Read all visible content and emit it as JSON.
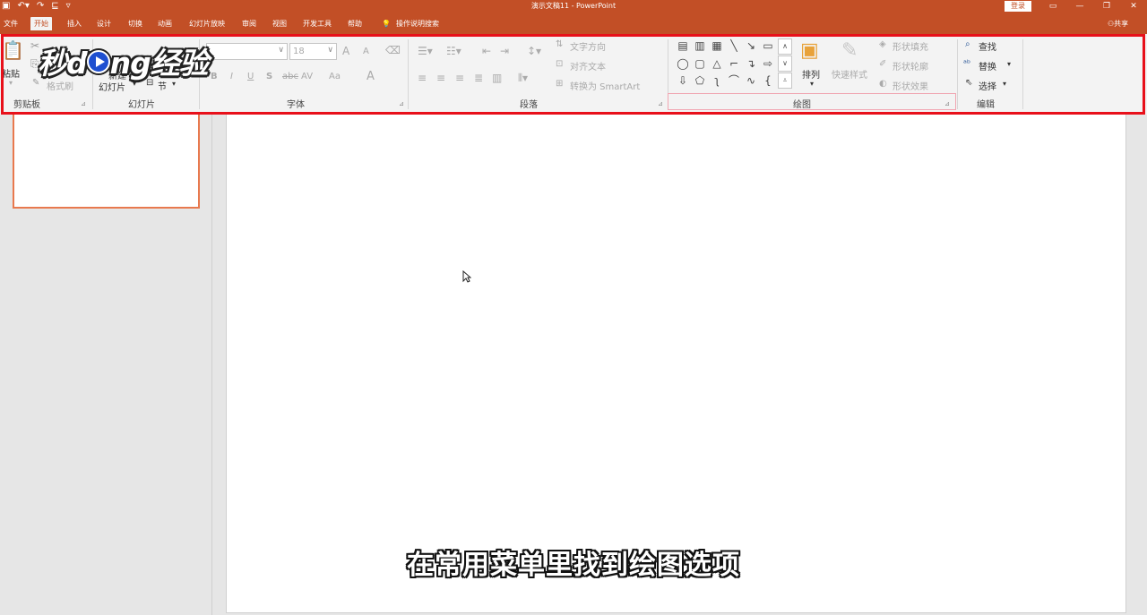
{
  "titlebar": {
    "title": "演示文稿11  -  PowerPoint",
    "login": "登录",
    "qa_icons": [
      "save-icon",
      "undo-icon",
      "redo-icon",
      "start-slideshow-icon",
      "customize-icon"
    ],
    "qa_glyphs": [
      "▣",
      "↶▾",
      "↷",
      "⊑",
      "▿"
    ],
    "winctl": [
      "▭",
      "—",
      "❐",
      "✕"
    ]
  },
  "tabs": [
    "文件",
    "开始",
    "插入",
    "设计",
    "切换",
    "动画",
    "幻灯片放映",
    "审阅",
    "视图",
    "开发工具",
    "帮助",
    "操作说明搜索"
  ],
  "active_tab": "开始",
  "share": "共享",
  "ribbon": {
    "clipboard": {
      "paste": "粘贴",
      "format_painter": "格式刷",
      "label": "剪贴板"
    },
    "slides": {
      "new_slide_1": "新建",
      "new_slide_2": "幻灯片",
      "section": "节",
      "label": "幻灯片"
    },
    "font": {
      "size": "18",
      "bold": "B",
      "italic": "I",
      "underline": "U",
      "shadow": "S",
      "strike": "abc",
      "spacing": "AV",
      "case": "Aa",
      "color": "A",
      "grow": "A",
      "shrink": "A",
      "label": "字体"
    },
    "paragraph": {
      "text_direction": "文字方向",
      "align_text": "对齐文本",
      "smartart": "转换为 SmartArt",
      "label": "段落"
    },
    "drawing": {
      "arrange": "排列",
      "quick_styles": "快速样式",
      "fill": "形状填充",
      "outline": "形状轮廓",
      "effects": "形状效果",
      "label": "绘图"
    },
    "editing": {
      "find": "查找",
      "replace": "替换",
      "select": "选择",
      "label": "编辑"
    }
  },
  "logo": {
    "pre": "秒d",
    "post": "ng经验"
  },
  "subtitle": "在常用菜单里找到绘图选项",
  "colors": {
    "accent": "#c24f26",
    "highlight": "#e8101a"
  }
}
